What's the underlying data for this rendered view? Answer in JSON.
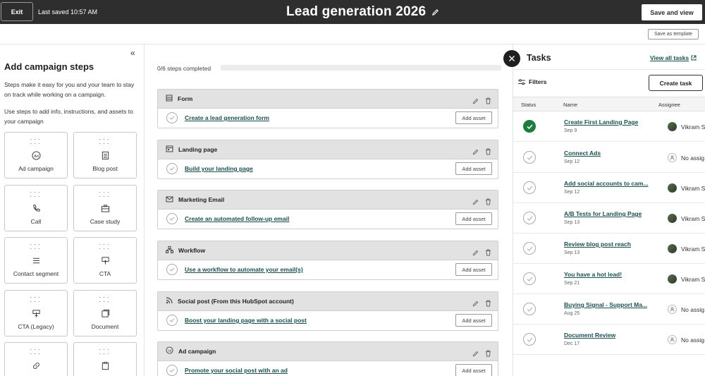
{
  "header": {
    "exit_label": "Exit",
    "last_saved": "Last saved 10:57 AM",
    "title": "Lead generation 2026",
    "save_view_label": "Save and view",
    "save_template_label": "Save as template"
  },
  "left": {
    "title": "Add campaign steps",
    "desc1": "Steps make it easy for you and your team to stay on track while working on a campaign.",
    "desc2": "Use steps to add info, instructions, and assets to your campaign",
    "cards": [
      {
        "label": "Ad campaign",
        "icon": "ad-icon"
      },
      {
        "label": "Blog post",
        "icon": "blog-icon"
      },
      {
        "label": "Call",
        "icon": "phone-icon"
      },
      {
        "label": "Case study",
        "icon": "briefcase-icon"
      },
      {
        "label": "Contact segment",
        "icon": "list-icon"
      },
      {
        "label": "CTA",
        "icon": "cta-icon"
      },
      {
        "label": "CTA (Legacy)",
        "icon": "cta-legacy-icon"
      },
      {
        "label": "Document",
        "icon": "document-icon"
      },
      {
        "label": "",
        "icon": "link-icon"
      },
      {
        "label": "",
        "icon": "clipboard-icon"
      }
    ]
  },
  "middle": {
    "progress_text": "0/6 steps completed",
    "progress_value": 0,
    "steps": [
      {
        "type": "Form",
        "icon": "form-icon",
        "link": "Create a lead generation form",
        "button": "Add asset"
      },
      {
        "type": "Landing page",
        "icon": "landing-page-icon",
        "link": "Build your landing page",
        "button": "Add asset"
      },
      {
        "type": "Marketing Email",
        "icon": "email-icon",
        "link": "Create an automated follow-up email",
        "button": "Add asset"
      },
      {
        "type": "Workflow",
        "icon": "workflow-icon",
        "link": "Use a workflow to automate your email(s)",
        "button": "Add asset"
      },
      {
        "type": "Social post (From this HubSpot account)",
        "icon": "rss-icon",
        "link": "Boost your landing page with a social post",
        "button": "Add asset"
      },
      {
        "type": "Ad campaign",
        "icon": "ad-icon",
        "link": "Promote your social post with an ad",
        "button": "Add asset"
      }
    ]
  },
  "tasks": {
    "title": "Tasks",
    "view_all": "View all tasks",
    "filters": "Filters",
    "create_task": "Create task",
    "columns": [
      "Status",
      "Name",
      "Assignee"
    ],
    "rows": [
      {
        "name": "Create First Landing Page",
        "date": "Sep 9",
        "assignee": "Vikram S",
        "done": true,
        "has_avatar": true
      },
      {
        "name": "Connect Ads",
        "date": "Sep 12",
        "assignee": "No assig",
        "done": false,
        "has_avatar": false
      },
      {
        "name": "Add social accounts to cam...",
        "date": "Sep 12",
        "assignee": "Vikram S",
        "done": false,
        "has_avatar": true
      },
      {
        "name": "A/B Tests for Landing Page",
        "date": "Sep 13",
        "assignee": "Vikram S",
        "done": false,
        "has_avatar": true
      },
      {
        "name": "Review blog post reach",
        "date": "Sep 13",
        "assignee": "Vikram S",
        "done": false,
        "has_avatar": true
      },
      {
        "name": "You have a hot lead!",
        "date": "Sep 21",
        "assignee": "Vikram S",
        "done": false,
        "has_avatar": true
      },
      {
        "name": "Buying Signal - Support Ma...",
        "date": "Aug 25",
        "assignee": "No assig",
        "done": false,
        "has_avatar": false
      },
      {
        "name": "Document Review",
        "date": "Dec 17",
        "assignee": "No assig",
        "done": false,
        "has_avatar": false
      }
    ]
  }
}
